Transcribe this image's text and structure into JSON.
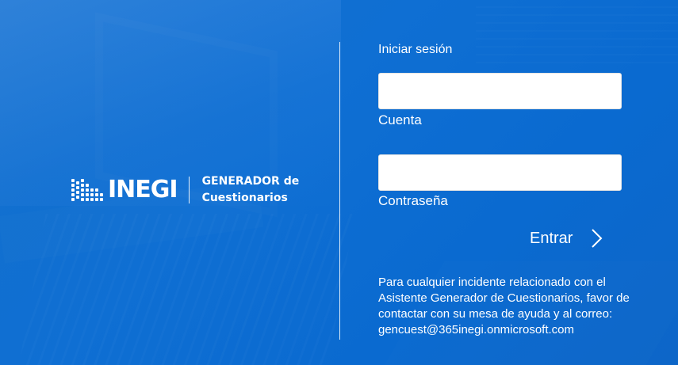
{
  "brand": {
    "logo_text": "INEGI",
    "product_line1": "GENERADOR de",
    "product_line2": "Cuestionarios"
  },
  "login": {
    "title": "Iniciar sesión",
    "account_label": "Cuenta",
    "account_value": "",
    "password_label": "Contraseña",
    "password_value": "",
    "submit_label": "Entrar",
    "submit_icon": "chevron-right-icon"
  },
  "help": {
    "message": "Para cualquier incidente relacionado con el Asistente Generador de Cuestionarios, favor de contactar con su mesa de ayuda y al correo: gencuest@365inegi.onmicrosoft.com"
  },
  "colors": {
    "background": "#0a6fd6",
    "text": "#ffffff",
    "field_bg": "#ffffff"
  }
}
